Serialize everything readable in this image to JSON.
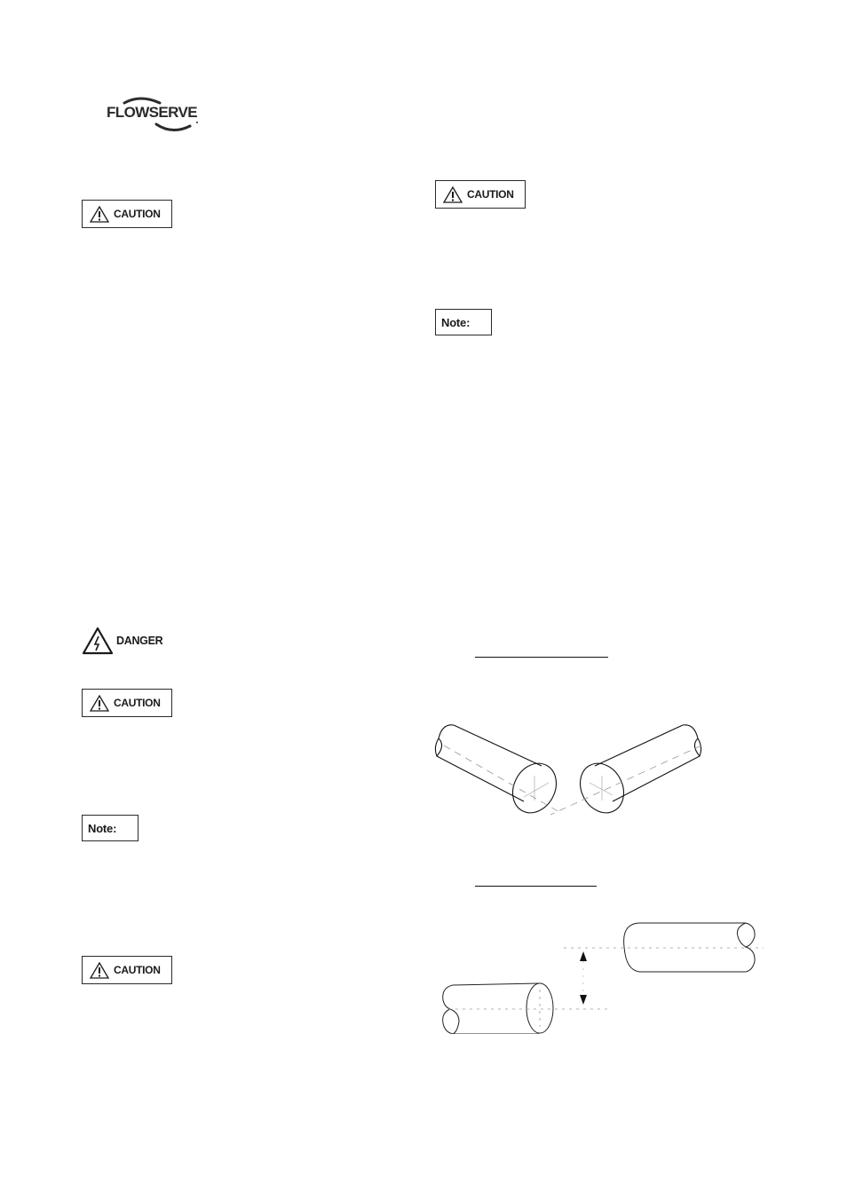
{
  "header": {
    "logo_text": "FLOWSERVE",
    "logo_icon": "flowserve-swoosh-logo"
  },
  "left_column": {
    "notices": [
      {
        "type": "caution",
        "label": "CAUTION",
        "icon": "warning-triangle-icon"
      },
      {
        "type": "danger",
        "label": "DANGER",
        "icon": "electrical-hazard-icon"
      },
      {
        "type": "caution",
        "label": "CAUTION",
        "icon": "warning-triangle-icon"
      },
      {
        "type": "note",
        "label": "Note:"
      },
      {
        "type": "caution",
        "label": "CAUTION",
        "icon": "warning-triangle-icon"
      }
    ]
  },
  "right_column": {
    "notices": [
      {
        "type": "caution",
        "label": "CAUTION",
        "icon": "warning-triangle-icon"
      },
      {
        "type": "note",
        "label": "Note:"
      }
    ],
    "figures": [
      {
        "name": "angular-misalignment-diagram",
        "caption": "",
        "description": "Two shafts meeting at an angle"
      },
      {
        "name": "parallel-misalignment-diagram",
        "caption": "",
        "description": "Two parallel shafts offset vertically with dimension arrows"
      }
    ]
  }
}
